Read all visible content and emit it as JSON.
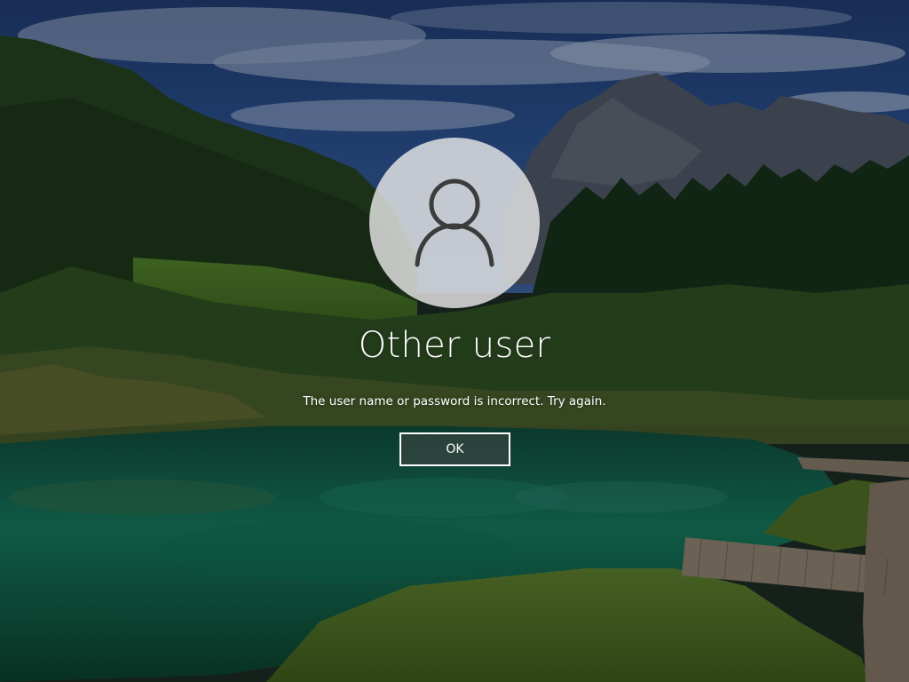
{
  "lock_screen": {
    "user_name": "Other user",
    "error_message": "The user name or password is incorrect. Try again.",
    "ok_label": "OK",
    "avatar_icon": "user-silhouette-icon"
  },
  "colors": {
    "text": "#ffffff",
    "avatar_circle": "#e6e6e6",
    "avatar_icon": "#3c3c3c",
    "button_border": "#ffffff"
  }
}
